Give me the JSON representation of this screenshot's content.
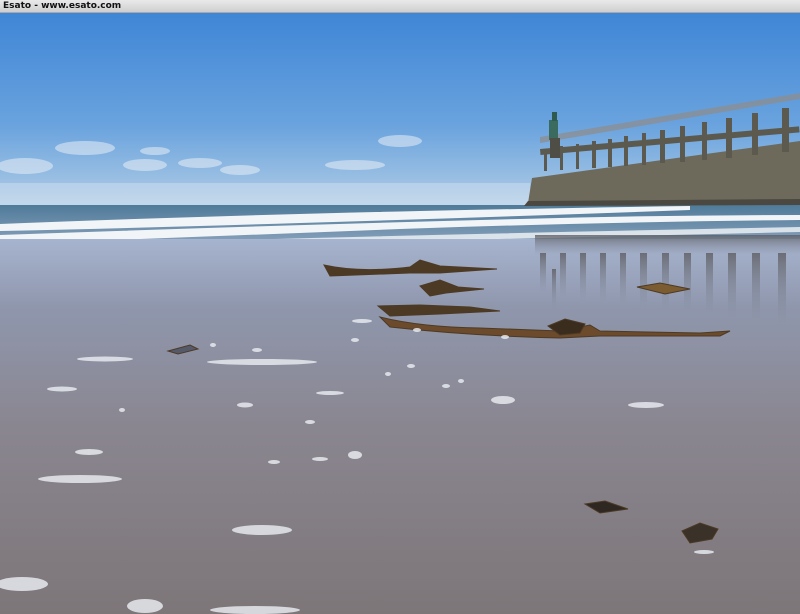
{
  "caption": "Esato - www.esato.com",
  "colors": {
    "sky_top": "#3f86d6",
    "sky_horizon": "#bcd3e6",
    "sea": "#6c8ca8",
    "wet_sand": "#8a8a95",
    "pier": "#5c5a4e"
  }
}
